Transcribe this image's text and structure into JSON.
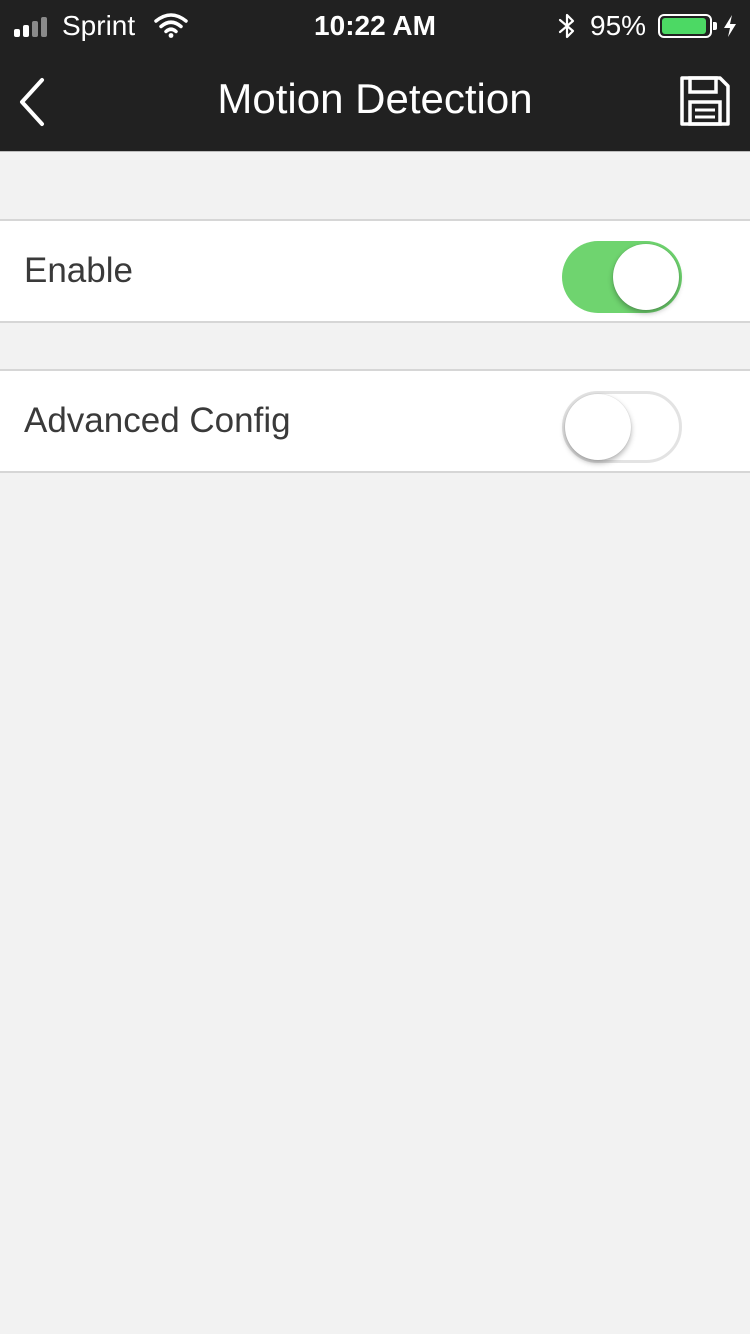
{
  "status_bar": {
    "carrier": "Sprint",
    "time": "10:22 AM",
    "battery_percent": "95%",
    "battery_level": 0.95,
    "icons": [
      "signal-bars-icon",
      "wifi-icon",
      "bluetooth-icon",
      "battery-icon",
      "charging-bolt-icon"
    ]
  },
  "nav": {
    "title": "Motion Detection",
    "back_icon": "chevron-left-icon",
    "save_icon": "floppy-disk-save-icon"
  },
  "settings": [
    {
      "label": "Enable",
      "enabled": true
    },
    {
      "label": "Advanced Config",
      "enabled": false
    }
  ],
  "colors": {
    "header_bg": "#212121",
    "page_bg": "#f2f2f2",
    "toggle_on": "#6fd46f",
    "battery_fill": "#4cd964"
  }
}
